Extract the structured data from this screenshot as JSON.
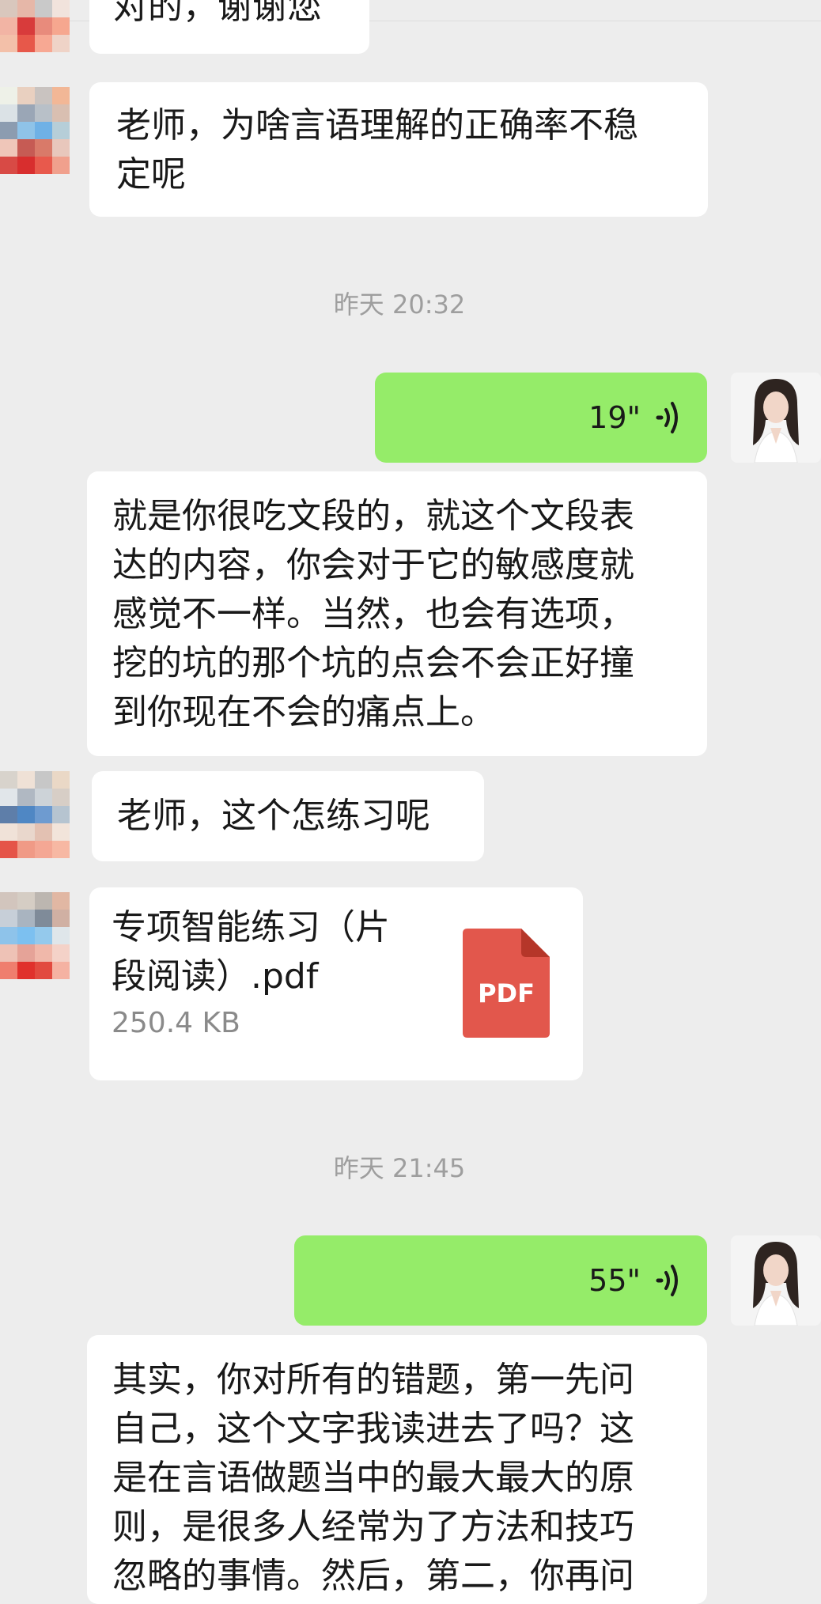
{
  "messages": {
    "top_partial": "对的，谢谢您",
    "q1_lines": [
      "老师，为啥言语理解的正确率不稳",
      "定呢"
    ],
    "ts1": "昨天 20:32",
    "voice1": "19\"",
    "reply1_lines": [
      "就是你很吃文段的，就这个文段表",
      "达的内容，你会对于它的敏感度就",
      "感觉不一样。当然，也会有选项，",
      "挖的坑的那个坑的点会不会正好撞",
      "到你现在不会的痛点上。"
    ],
    "q2": "老师，这个怎练习呢",
    "file": {
      "name_lines": [
        "专项智能练习（片",
        "段阅读）.pdf"
      ],
      "size": "250.4 KB",
      "icon_label": "PDF"
    },
    "ts2": "昨天 21:45",
    "voice2": "55\"",
    "reply2_lines": [
      "其实，你对所有的错题，第一先问",
      "自己，这个文字我读进去了吗？这",
      "是在言语做题当中的最大最大的原",
      "则，是很多人经常为了方法和技巧",
      "忽略的事情。然后，第二，你再问"
    ]
  },
  "colors": {
    "background": "#ededed",
    "outgoing_bubble": "#95ec69",
    "incoming_bubble": "#ffffff",
    "pdf_red": "#e2574c",
    "timestamp": "#9e9e9e"
  },
  "icons": [
    "voice-wave-icon",
    "pdf-file-icon",
    "user-avatar",
    "teacher-avatar"
  ]
}
